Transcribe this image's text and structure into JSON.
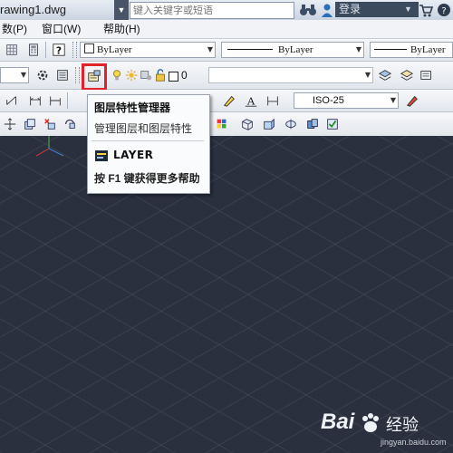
{
  "titlebar": {
    "file_name": "rawing1.dwg",
    "search_placeholder": "键入关键字或短语",
    "login_label": "登录"
  },
  "menubar": {
    "items": [
      {
        "label": "数(P)"
      },
      {
        "label": "窗口(W)"
      },
      {
        "label": "帮助(H)"
      }
    ]
  },
  "properties_toolbar": {
    "color_combo": "ByLayer",
    "linetype_combo": "ByLayer",
    "lineweight_combo": "ByLayer"
  },
  "layers_toolbar": {
    "current_layer": "0"
  },
  "dim_toolbar": {
    "dimstyle_combo": "ISO-25"
  },
  "tooltip": {
    "title": "图层特性管理器",
    "description": "管理图层和图层特性",
    "command": "LAYER",
    "help_text": "按 F1 键获得更多帮助"
  },
  "watermark": {
    "brand": "Bai",
    "brand_suffix": "经验",
    "url": "jingyan.baidu.com"
  },
  "colors": {
    "highlight": "#e0222b",
    "canvas": "#2a303d"
  },
  "icons": [
    "binoculars-icon",
    "user-icon",
    "cart-icon",
    "help-icon",
    "calculator-icon",
    "question-icon",
    "gear-icon",
    "layer-state-icon",
    "layer-properties-icon",
    "bulb-icon",
    "sun-icon",
    "lock-icon",
    "color-swatch-icon",
    "layer-icon",
    "dim-icon",
    "ucs-icon"
  ]
}
